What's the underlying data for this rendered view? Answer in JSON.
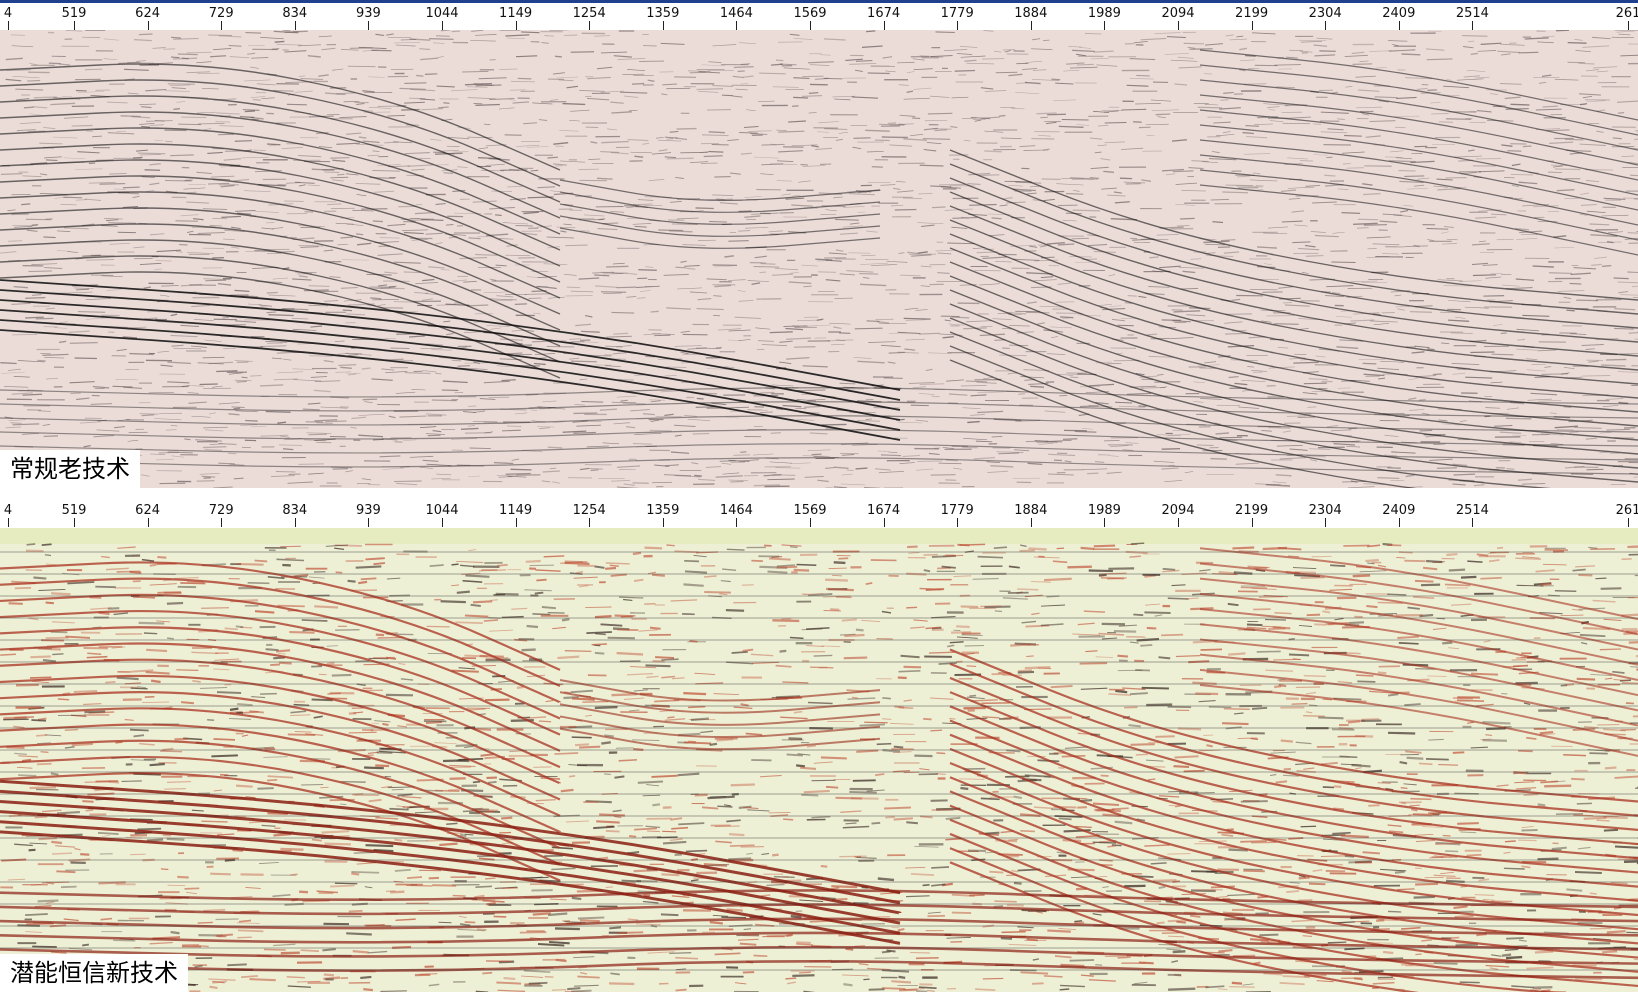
{
  "ruler": {
    "first_label": "4",
    "labels": [
      "519",
      "624",
      "729",
      "834",
      "939",
      "1044",
      "1149",
      "1254",
      "1359",
      "1464",
      "1569",
      "1674",
      "1779",
      "1884",
      "1989",
      "2094",
      "2199",
      "2304",
      "2409",
      "2514"
    ],
    "last_label": "261"
  },
  "panels": [
    {
      "caption": "常规老技术",
      "palette": "grayscale",
      "background": "#ecdcd8",
      "trace_color": "#1a1a1a"
    },
    {
      "caption": "潜能恒信新技术",
      "palette": "red-green",
      "background": "#eef0d6",
      "trace_color": "#b8402a",
      "top_band": "#e6ecc0"
    }
  ]
}
